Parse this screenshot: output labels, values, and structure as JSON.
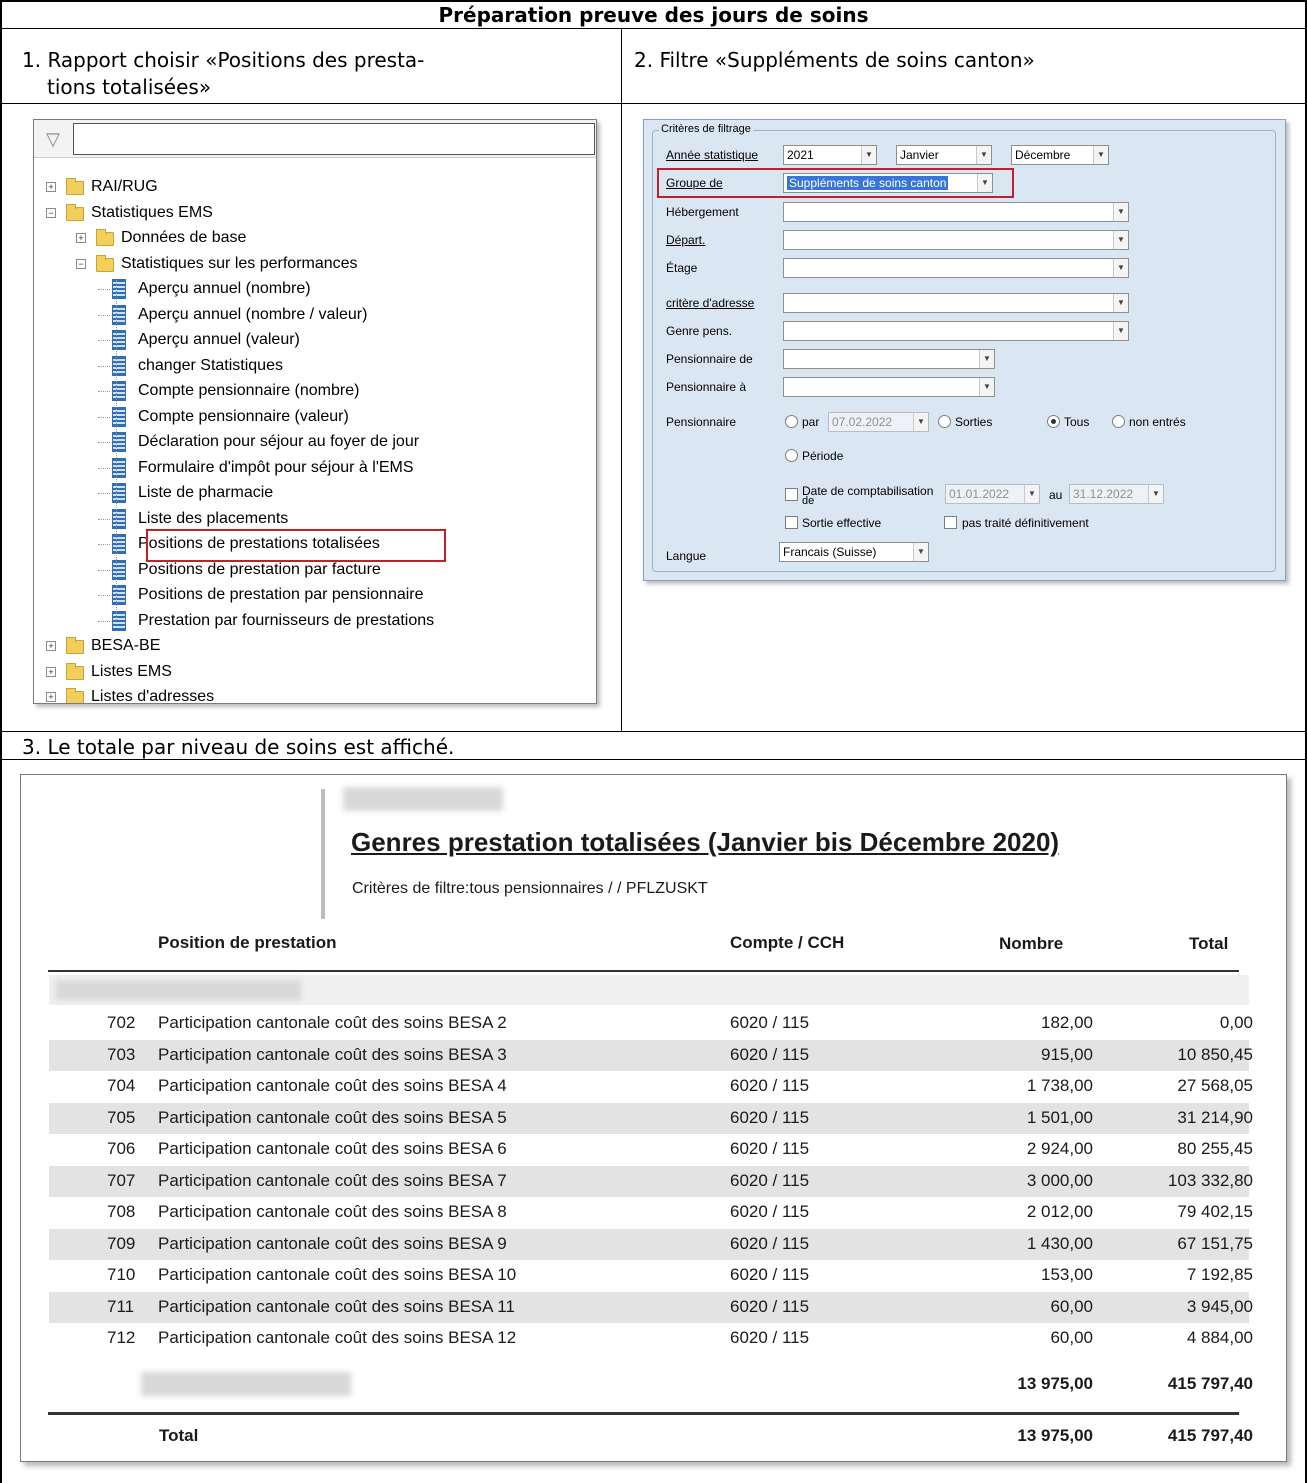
{
  "header": {
    "title": "Préparation preuve des jours de soins"
  },
  "steps": {
    "step1_line1": "1. Rapport choisir «Positions des presta-",
    "step1_line2": "tions totalisées»",
    "step2": "2. Filtre «Suppléments de soins canton»",
    "step3": "3. Le totale par niveau de soins est affiché."
  },
  "tree": {
    "search_value": "",
    "items": [
      {
        "label": "RAI/RUG",
        "type": "folder"
      },
      {
        "label": "Statistiques EMS",
        "type": "folder"
      },
      {
        "label": "Données de base",
        "type": "folder"
      },
      {
        "label": "Statistiques sur les performances",
        "type": "folder"
      },
      {
        "label": "Aperçu annuel (nombre)",
        "type": "report"
      },
      {
        "label": "Aperçu annuel (nombre / valeur)",
        "type": "report"
      },
      {
        "label": "Aperçu annuel (valeur)",
        "type": "report"
      },
      {
        "label": "changer Statistiques",
        "type": "report"
      },
      {
        "label": "Compte pensionnaire (nombre)",
        "type": "report"
      },
      {
        "label": "Compte pensionnaire (valeur)",
        "type": "report"
      },
      {
        "label": "Déclaration pour séjour au foyer de jour",
        "type": "report"
      },
      {
        "label": "Formulaire d'impôt pour séjour à l'EMS",
        "type": "report"
      },
      {
        "label": "Liste de pharmacie",
        "type": "report"
      },
      {
        "label": "Liste des placements",
        "type": "report"
      },
      {
        "label": "Positions de prestations totalisées",
        "type": "report",
        "highlighted": true
      },
      {
        "label": "Positions de prestation par facture",
        "type": "report"
      },
      {
        "label": "Positions de prestation par pensionnaire",
        "type": "report"
      },
      {
        "label": "Prestation par fournisseurs de prestations",
        "type": "report"
      },
      {
        "label": "BESA-BE",
        "type": "folder"
      },
      {
        "label": "Listes EMS",
        "type": "folder"
      },
      {
        "label": "Listes d'adresses",
        "type": "folder"
      }
    ]
  },
  "filter": {
    "legend": "Critères de filtrage",
    "annee_label": "Année statistique",
    "annee_value": "2021",
    "mois_debut": "Janvier",
    "mois_fin": "Décembre",
    "groupe_label": "Groupe de",
    "groupe_value": "Suppléments de soins canton",
    "hebergement_label": "Hébergement",
    "depart_label": "Départ.",
    "etage_label": "Étage",
    "adresse_label": "critère d'adresse",
    "genre_label": "Genre pens.",
    "pens_de_label": "Pensionnaire de",
    "pens_a_label": "Pensionnaire à",
    "pensionnaire_label": "Pensionnaire",
    "radio_par": "par",
    "radio_par_date": "07.02.2022",
    "radio_sorties": "Sorties",
    "radio_tous": "Tous",
    "radio_non_entres": "non entrés",
    "radio_periode": "Période",
    "date_compta_label_1": "Date de comptabilisation",
    "date_compta_label_2": "de",
    "date_compta_from": "01.01.2022",
    "au_label": "au",
    "date_compta_to": "31.12.2022",
    "sortie_effective": "Sortie effective",
    "pas_traite": "pas traité définitivement",
    "langue_label": "Langue",
    "langue_value": "Francais (Suisse)",
    "colors": {
      "panel": "#dbe6f3",
      "highlight": "#c0202c"
    }
  },
  "report": {
    "title": "Genres prestation totalisées (Janvier bis Décembre 2020)",
    "subtitle": "Critères de filtre:tous pensionnaires / / PFLZUSKT",
    "columns": {
      "position": "Position de prestation",
      "compte": "Compte / CCH",
      "nombre": "Nombre",
      "total": "Total"
    },
    "rows": [
      {
        "code": "702",
        "label": "Participation cantonale coût des soins BESA 2",
        "compte": "6020 / 115",
        "nombre": "182,00",
        "total": "0,00"
      },
      {
        "code": "703",
        "label": "Participation cantonale coût des soins BESA 3",
        "compte": "6020 / 115",
        "nombre": "915,00",
        "total": "10 850,45"
      },
      {
        "code": "704",
        "label": "Participation cantonale coût des soins BESA 4",
        "compte": "6020 / 115",
        "nombre": "1 738,00",
        "total": "27 568,05"
      },
      {
        "code": "705",
        "label": "Participation cantonale coût des soins BESA 5",
        "compte": "6020 / 115",
        "nombre": "1 501,00",
        "total": "31 214,90"
      },
      {
        "code": "706",
        "label": "Participation cantonale coût des soins BESA 6",
        "compte": "6020 / 115",
        "nombre": "2 924,00",
        "total": "80 255,45"
      },
      {
        "code": "707",
        "label": "Participation cantonale coût des soins BESA 7",
        "compte": "6020 / 115",
        "nombre": "3 000,00",
        "total": "103 332,80"
      },
      {
        "code": "708",
        "label": "Participation cantonale coût des soins BESA 8",
        "compte": "6020 / 115",
        "nombre": "2 012,00",
        "total": "79 402,15"
      },
      {
        "code": "709",
        "label": "Participation cantonale coût des soins BESA 9",
        "compte": "6020 / 115",
        "nombre": "1 430,00",
        "total": "67 151,75"
      },
      {
        "code": "710",
        "label": "Participation cantonale coût des soins BESA 10",
        "compte": "6020 / 115",
        "nombre": "153,00",
        "total": "7 192,85"
      },
      {
        "code": "711",
        "label": "Participation cantonale coût des soins BESA 11",
        "compte": "6020 / 115",
        "nombre": "60,00",
        "total": "3 945,00"
      },
      {
        "code": "712",
        "label": "Participation cantonale coût des soins BESA 12",
        "compte": "6020 / 115",
        "nombre": "60,00",
        "total": "4 884,00"
      }
    ],
    "subtotal": {
      "nombre": "13 975,00",
      "total": "415 797,40"
    },
    "grand_total": {
      "label": "Total",
      "nombre": "13 975,00",
      "total": "415 797,40"
    }
  }
}
